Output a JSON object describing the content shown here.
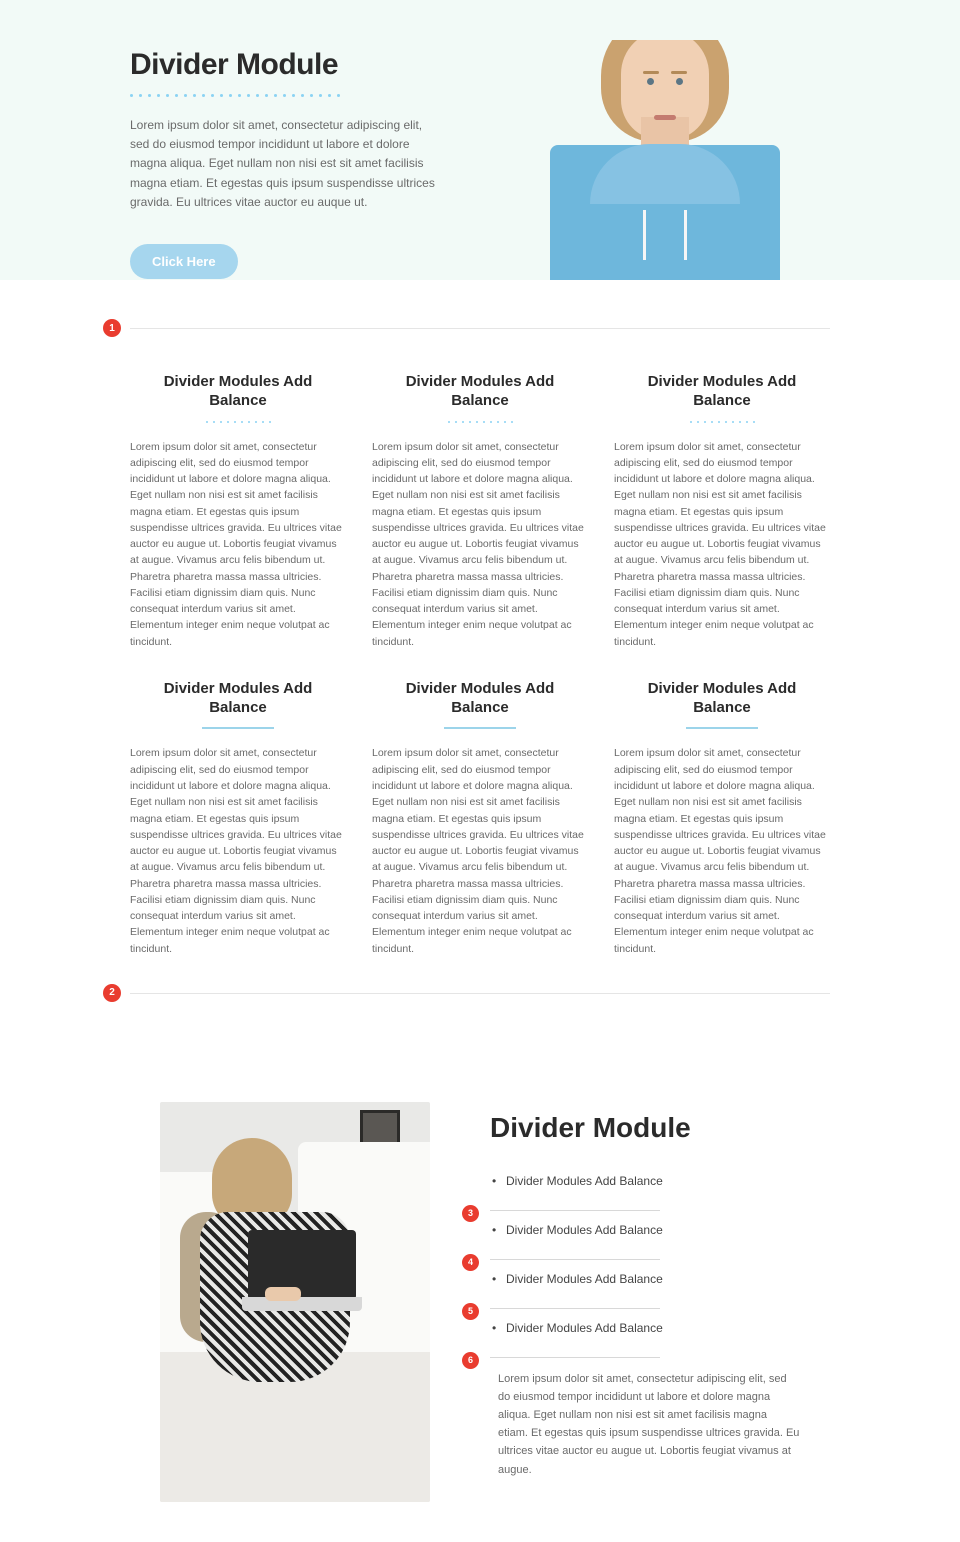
{
  "hero": {
    "title": "Divider Module",
    "paragraph": "Lorem ipsum dolor sit amet, consectetur adipiscing elit, sed do eiusmod tempor incididunt ut labore et dolore magna aliqua. Eget nullam non nisi est sit amet facilisis magna etiam. Et egestas quis ipsum suspendisse ultrices gravida. Eu ultrices vitae auctor eu auque ut.",
    "button_label": "Click Here"
  },
  "markers": {
    "m1": "1",
    "m2": "2",
    "m3": "3",
    "m4": "4",
    "m5": "5",
    "m6": "6"
  },
  "features_row1": [
    {
      "title": "Divider Modules Add Balance",
      "body": "Lorem ipsum dolor sit amet, consectetur adipiscing elit, sed do eiusmod tempor incididunt ut labore et dolore magna aliqua. Eget nullam non nisi est sit amet facilisis magna etiam. Et egestas quis ipsum suspendisse ultrices gravida. Eu ultrices vitae auctor eu augue ut. Lobortis feugiat vivamus at augue. Vivamus arcu felis bibendum ut. Pharetra pharetra massa massa ultricies. Facilisi etiam dignissim diam quis. Nunc consequat interdum varius sit amet. Elementum integer enim neque volutpat ac tincidunt."
    },
    {
      "title": "Divider Modules Add Balance",
      "body": "Lorem ipsum dolor sit amet, consectetur adipiscing elit, sed do eiusmod tempor incididunt ut labore et dolore magna aliqua. Eget nullam non nisi est sit amet facilisis magna etiam. Et egestas quis ipsum suspendisse ultrices gravida. Eu ultrices vitae auctor eu augue ut. Lobortis feugiat vivamus at augue. Vivamus arcu felis bibendum ut. Pharetra pharetra massa massa ultricies. Facilisi etiam dignissim diam quis. Nunc consequat interdum varius sit amet. Elementum integer enim neque volutpat ac tincidunt."
    },
    {
      "title": "Divider Modules Add Balance",
      "body": "Lorem ipsum dolor sit amet, consectetur adipiscing elit, sed do eiusmod tempor incididunt ut labore et dolore magna aliqua. Eget nullam non nisi est sit amet facilisis magna etiam. Et egestas quis ipsum suspendisse ultrices gravida. Eu ultrices vitae auctor eu augue ut. Lobortis feugiat vivamus at augue. Vivamus arcu felis bibendum ut. Pharetra pharetra massa massa ultricies. Facilisi etiam dignissim diam quis. Nunc consequat interdum varius sit amet. Elementum integer enim neque volutpat ac tincidunt."
    }
  ],
  "features_row2": [
    {
      "title": "Divider Modules Add Balance",
      "body": "Lorem ipsum dolor sit amet, consectetur adipiscing elit, sed do eiusmod tempor incididunt ut labore et dolore magna aliqua. Eget nullam non nisi est sit amet facilisis magna etiam. Et egestas quis ipsum suspendisse ultrices gravida. Eu ultrices vitae auctor eu augue ut. Lobortis feugiat vivamus at augue. Vivamus arcu felis bibendum ut. Pharetra pharetra massa massa ultricies. Facilisi etiam dignissim diam quis. Nunc consequat interdum varius sit amet. Elementum integer enim neque volutpat ac tincidunt."
    },
    {
      "title": "Divider Modules Add Balance",
      "body": "Lorem ipsum dolor sit amet, consectetur adipiscing elit, sed do eiusmod tempor incididunt ut labore et dolore magna aliqua. Eget nullam non nisi est sit amet facilisis magna etiam. Et egestas quis ipsum suspendisse ultrices gravida. Eu ultrices vitae auctor eu augue ut. Lobortis feugiat vivamus at augue. Vivamus arcu felis bibendum ut. Pharetra pharetra massa massa ultricies. Facilisi etiam dignissim diam quis. Nunc consequat interdum varius sit amet. Elementum integer enim neque volutpat ac tincidunt."
    },
    {
      "title": "Divider Modules Add Balance",
      "body": "Lorem ipsum dolor sit amet, consectetur adipiscing elit, sed do eiusmod tempor incididunt ut labore et dolore magna aliqua. Eget nullam non nisi est sit amet facilisis magna etiam. Et egestas quis ipsum suspendisse ultrices gravida. Eu ultrices vitae auctor eu augue ut. Lobortis feugiat vivamus at augue. Vivamus arcu felis bibendum ut. Pharetra pharetra massa massa ultricies. Facilisi etiam dignissim diam quis. Nunc consequat interdum varius sit amet. Elementum integer enim neque volutpat ac tincidunt."
    }
  ],
  "bottom": {
    "title": "Divider Module",
    "bullets": [
      "Divider Modules Add Balance",
      "Divider Modules Add Balance",
      "Divider Modules Add Balance",
      "Divider Modules Add Balance"
    ],
    "paragraph": "Lorem ipsum dolor sit amet, consectetur adipiscing elit, sed do eiusmod tempor incididunt ut labore et dolore magna aliqua. Eget nullam non nisi est sit amet facilisis magna etiam. Et egestas quis ipsum suspendisse ultrices gravida. Eu ultrices vitae auctor eu augue ut. Lobortis feugiat vivamus at augue."
  }
}
